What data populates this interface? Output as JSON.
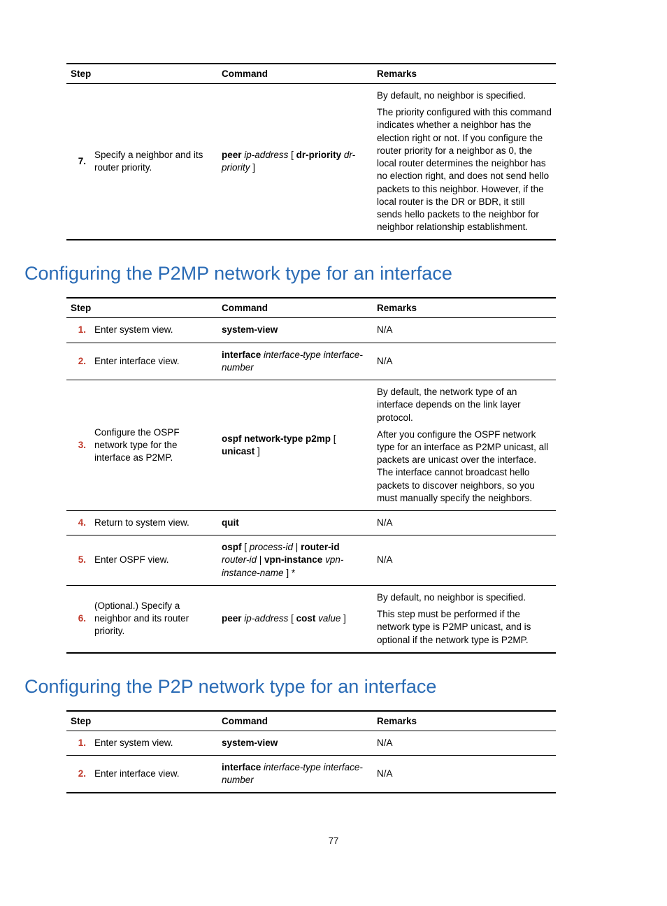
{
  "page_number": "77",
  "table1": {
    "headers": {
      "step": "Step",
      "command": "Command",
      "remarks": "Remarks"
    },
    "rows": [
      {
        "num": "7.",
        "desc": "Specify a neighbor and its router priority.",
        "cmd_parts": [
          {
            "t": "b",
            "v": "peer"
          },
          {
            "t": "p",
            "v": " "
          },
          {
            "t": "i",
            "v": "ip-address"
          },
          {
            "t": "p",
            "v": " [ "
          },
          {
            "t": "b",
            "v": "dr-priority"
          },
          {
            "t": "p",
            "v": " "
          },
          {
            "t": "i",
            "v": "dr-priority"
          },
          {
            "t": "p",
            "v": " ]"
          }
        ],
        "remarks_paras": [
          "By default, no neighbor is specified.",
          "The priority configured with this command indicates whether a neighbor has the election right or not. If you configure the router priority for a neighbor as 0, the local router determines the neighbor has no election right, and does not send hello packets to this neighbor. However, if the local router is the DR or BDR, it still sends hello packets to the neighbor for neighbor relationship establishment."
        ]
      }
    ]
  },
  "section2": {
    "title": "Configuring the P2MP network type for an interface",
    "headers": {
      "step": "Step",
      "command": "Command",
      "remarks": "Remarks"
    },
    "rows": [
      {
        "num": "1.",
        "red": true,
        "desc": "Enter system view.",
        "cmd_parts": [
          {
            "t": "b",
            "v": "system-view"
          }
        ],
        "remarks_paras": [
          "N/A"
        ]
      },
      {
        "num": "2.",
        "red": true,
        "desc": "Enter interface view.",
        "cmd_parts": [
          {
            "t": "b",
            "v": "interface"
          },
          {
            "t": "p",
            "v": " "
          },
          {
            "t": "i",
            "v": "interface-type interface-number"
          }
        ],
        "remarks_paras": [
          "N/A"
        ]
      },
      {
        "num": "3.",
        "red": true,
        "desc": "Configure the OSPF network type for the interface as P2MP.",
        "cmd_parts": [
          {
            "t": "b",
            "v": "ospf network-type p2mp"
          },
          {
            "t": "p",
            "v": " [ "
          },
          {
            "t": "b",
            "v": "unicast"
          },
          {
            "t": "p",
            "v": " ]"
          }
        ],
        "remarks_paras": [
          "By default, the network type of an interface depends on the link layer protocol.",
          "After you configure the OSPF network type for an interface as P2MP unicast, all packets are unicast over the interface. The interface cannot broadcast hello packets to discover neighbors, so you must manually specify the neighbors."
        ]
      },
      {
        "num": "4.",
        "red": true,
        "desc": "Return to system view.",
        "cmd_parts": [
          {
            "t": "b",
            "v": "quit"
          }
        ],
        "remarks_paras": [
          "N/A"
        ]
      },
      {
        "num": "5.",
        "red": true,
        "desc": "Enter OSPF view.",
        "cmd_parts": [
          {
            "t": "b",
            "v": "ospf"
          },
          {
            "t": "p",
            "v": " [ "
          },
          {
            "t": "i",
            "v": "process-id"
          },
          {
            "t": "p",
            "v": " | "
          },
          {
            "t": "b",
            "v": "router-id"
          },
          {
            "t": "p",
            "v": " "
          },
          {
            "t": "i",
            "v": "router-id"
          },
          {
            "t": "p",
            "v": " | "
          },
          {
            "t": "b",
            "v": "vpn-instance"
          },
          {
            "t": "p",
            "v": " "
          },
          {
            "t": "i",
            "v": "vpn-instance-name"
          },
          {
            "t": "p",
            "v": " ] *"
          }
        ],
        "remarks_paras": [
          "N/A"
        ]
      },
      {
        "num": "6.",
        "red": true,
        "desc": "(Optional.) Specify a neighbor and its router priority.",
        "cmd_parts": [
          {
            "t": "b",
            "v": "peer"
          },
          {
            "t": "p",
            "v": " "
          },
          {
            "t": "i",
            "v": "ip-address"
          },
          {
            "t": "p",
            "v": " [ "
          },
          {
            "t": "b",
            "v": "cost"
          },
          {
            "t": "p",
            "v": " "
          },
          {
            "t": "i",
            "v": "value"
          },
          {
            "t": "p",
            "v": " ]"
          }
        ],
        "remarks_paras": [
          "By default, no neighbor is specified.",
          "This step must be performed if the network type is P2MP unicast, and is optional if the network type is P2MP."
        ]
      }
    ]
  },
  "section3": {
    "title": "Configuring the P2P network type for an interface",
    "headers": {
      "step": "Step",
      "command": "Command",
      "remarks": "Remarks"
    },
    "rows": [
      {
        "num": "1.",
        "red": true,
        "desc": "Enter system view.",
        "cmd_parts": [
          {
            "t": "b",
            "v": "system-view"
          }
        ],
        "remarks_paras": [
          "N/A"
        ]
      },
      {
        "num": "2.",
        "red": true,
        "desc": "Enter interface view.",
        "cmd_parts": [
          {
            "t": "b",
            "v": "interface"
          },
          {
            "t": "p",
            "v": " "
          },
          {
            "t": "i",
            "v": "interface-type interface-number"
          }
        ],
        "remarks_paras": [
          "N/A"
        ]
      }
    ]
  }
}
